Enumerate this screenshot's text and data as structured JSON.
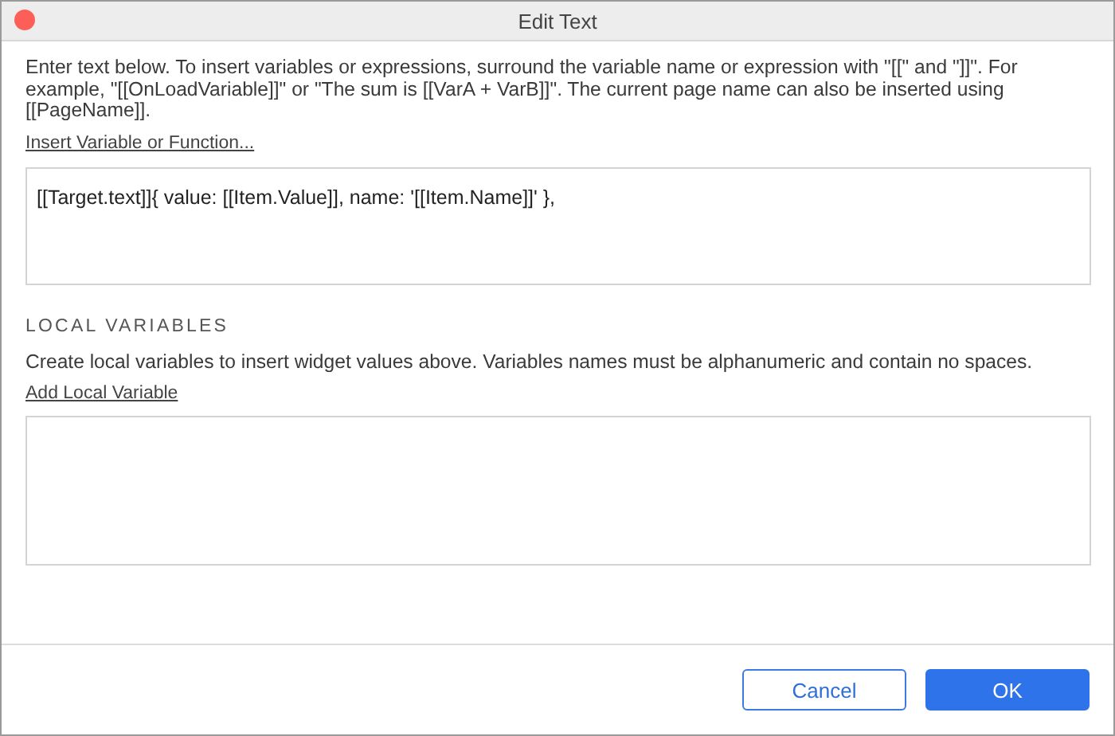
{
  "window": {
    "title": "Edit Text"
  },
  "instructions": "Enter text below. To insert variables or expressions, surround the variable name or expression with \"[[\" and \"]]\". For example, \"[[OnLoadVariable]]\" or \"The sum is [[VarA + VarB]]\". The current page name can also be inserted using [[PageName]].",
  "insert_link": "Insert Variable or Function...",
  "text_field": {
    "value": "[[Target.text]]{ value: [[Item.Value]], name: '[[Item.Name]]' },"
  },
  "local_variables": {
    "heading": "LOCAL VARIABLES",
    "description": "Create local variables to insert widget values above. Variables names must be alphanumeric and contain no spaces.",
    "add_link": "Add Local Variable"
  },
  "buttons": [
    {
      "label": "Cancel",
      "kind": "secondary"
    },
    {
      "label": "OK",
      "kind": "primary"
    }
  ]
}
